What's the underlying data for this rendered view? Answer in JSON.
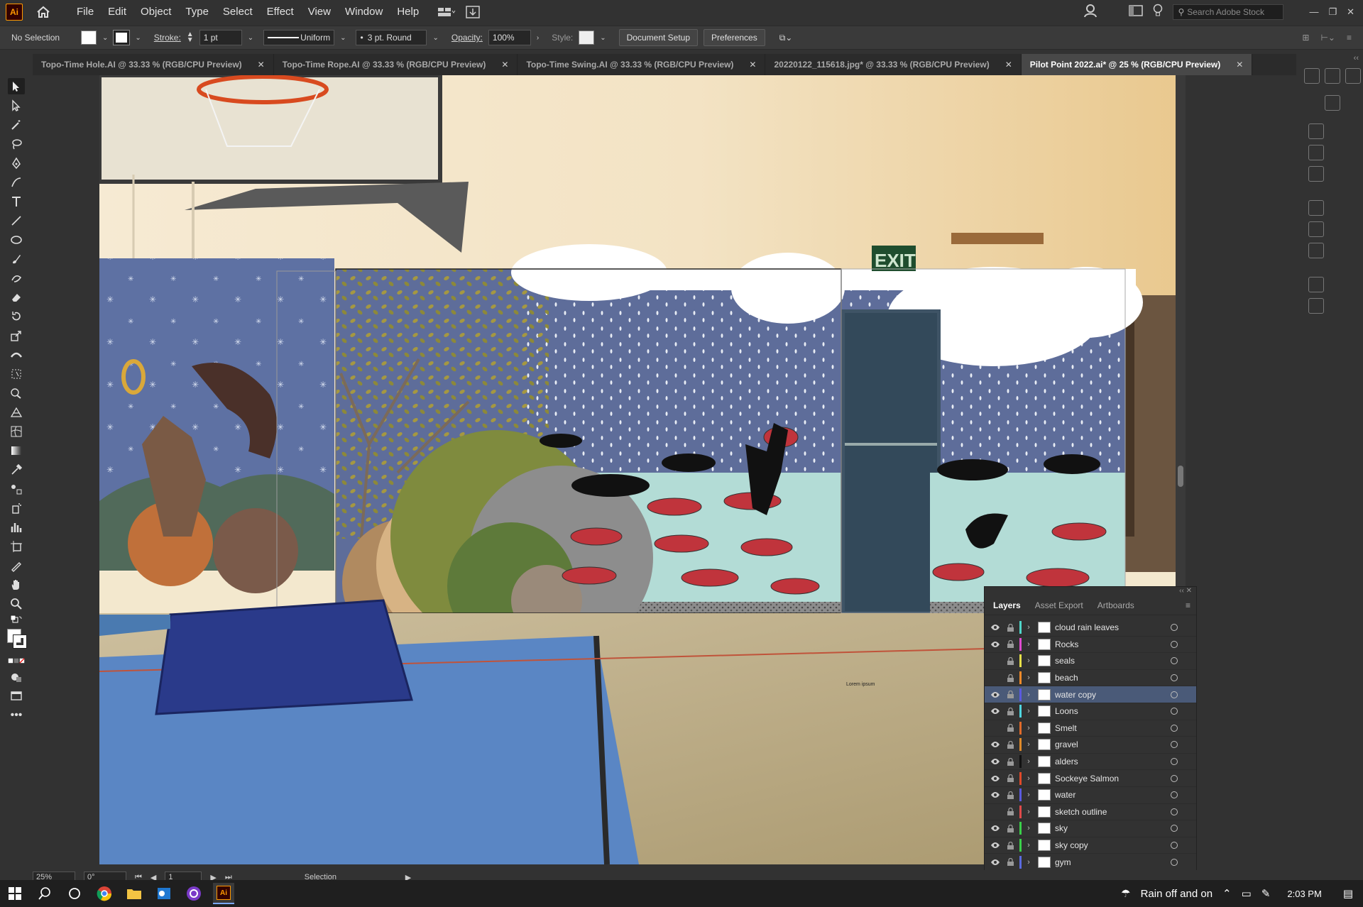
{
  "menubar": {
    "app_logo": "Ai",
    "items": [
      "File",
      "Edit",
      "Object",
      "Type",
      "Select",
      "Effect",
      "View",
      "Window",
      "Help"
    ],
    "stock_search_placeholder": "Search Adobe Stock"
  },
  "controlbar": {
    "selection_label": "No Selection",
    "stroke_label": "Stroke:",
    "stroke_weight": "1 pt",
    "stroke_profile": "Uniform",
    "brush": "3 pt. Round",
    "opacity_label": "Opacity:",
    "opacity_value": "100%",
    "style_label": "Style:",
    "document_setup": "Document Setup",
    "preferences": "Preferences"
  },
  "tabs": [
    {
      "label": "Topo-Time Hole.AI @ 33.33 % (RGB/CPU Preview)",
      "active": false
    },
    {
      "label": "Topo-Time Rope.AI @ 33.33 % (RGB/CPU Preview)",
      "active": false
    },
    {
      "label": "Topo-Time Swing.AI @ 33.33 % (RGB/CPU Preview)",
      "active": false
    },
    {
      "label": "20220122_115618.jpg* @ 33.33 % (RGB/CPU Preview)",
      "active": false
    },
    {
      "label": "Pilot Point 2022.ai* @ 25 % (RGB/CPU Preview)",
      "active": true
    }
  ],
  "canvas": {
    "exit_sign": "EXIT",
    "placeholder_text": "Lorem ipsum"
  },
  "layers_panel": {
    "tabs": [
      "Layers",
      "Asset Export",
      "Artboards"
    ],
    "layers": [
      {
        "name": "cloud rain leaves",
        "visible": true,
        "color": "#4fd6c9",
        "selected": false
      },
      {
        "name": "Rocks",
        "visible": true,
        "color": "#e04bd0",
        "selected": false
      },
      {
        "name": "seals",
        "visible": false,
        "color": "#e8e04a",
        "selected": false
      },
      {
        "name": "beach",
        "visible": false,
        "color": "#f08a2a",
        "selected": false
      },
      {
        "name": "water copy",
        "visible": true,
        "color": "#5a5ae0",
        "selected": true
      },
      {
        "name": "Loons",
        "visible": true,
        "color": "#4fd6e0",
        "selected": false
      },
      {
        "name": "Smelt",
        "visible": false,
        "color": "#e06a2a",
        "selected": false
      },
      {
        "name": "gravel",
        "visible": true,
        "color": "#e08a2a",
        "selected": false
      },
      {
        "name": "alders",
        "visible": true,
        "color": "#111111",
        "selected": false
      },
      {
        "name": "Sockeye Salmon",
        "visible": true,
        "color": "#e04a2a",
        "selected": false
      },
      {
        "name": "water",
        "visible": true,
        "color": "#5a5ae0",
        "selected": false
      },
      {
        "name": "sketch outline",
        "visible": false,
        "color": "#e04a4a",
        "selected": false
      },
      {
        "name": "sky",
        "visible": true,
        "color": "#3ad04a",
        "selected": false
      },
      {
        "name": "sky copy",
        "visible": true,
        "color": "#3ad04a",
        "selected": false
      },
      {
        "name": "gym",
        "visible": true,
        "color": "#5a6ae0",
        "selected": false
      }
    ]
  },
  "statusbar": {
    "zoom": "25%",
    "rotation": "0°",
    "artboard": "1",
    "tool": "Selection"
  },
  "taskbar": {
    "weather": "Rain off and on",
    "time": "2:03 PM"
  },
  "colors": {
    "ui_bg": "#323232",
    "selected_layer": "#4a5a78",
    "mural_sky": "#5d6f9a",
    "mural_water": "#b3dcd6",
    "salmon": "#c0343c"
  }
}
